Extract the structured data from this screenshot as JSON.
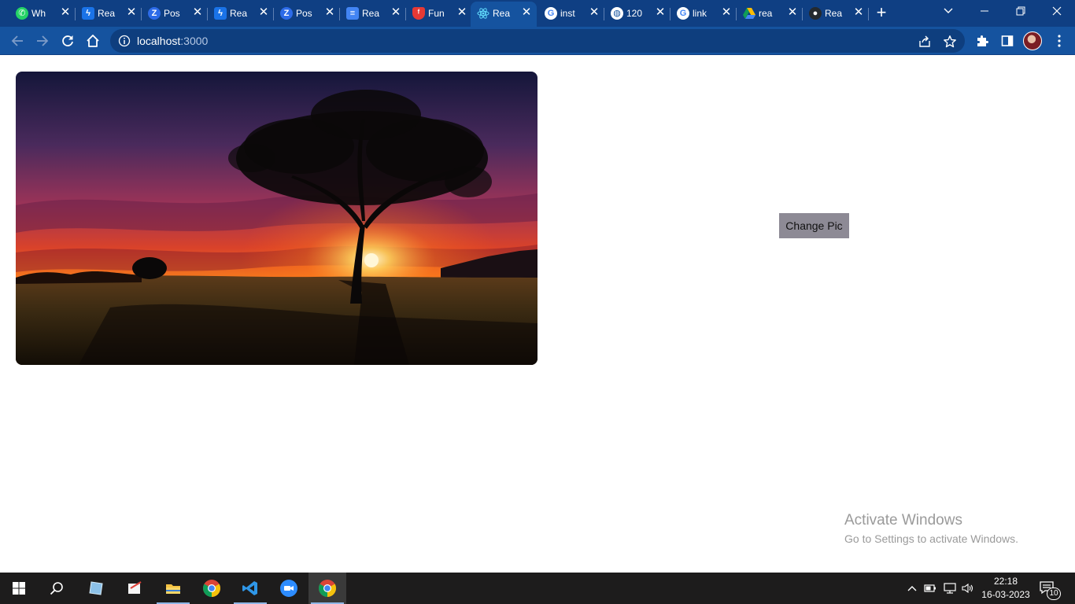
{
  "browser": {
    "tabs": [
      {
        "title": "Wh",
        "icon": "whatsapp-icon",
        "color": "#25d366"
      },
      {
        "title": "Rea",
        "icon": "bolt-icon",
        "color": "#1a73e8"
      },
      {
        "title": "Pos",
        "icon": "zoho-icon",
        "color": "#2d6be8"
      },
      {
        "title": "Rea",
        "icon": "bolt-icon",
        "color": "#1a73e8"
      },
      {
        "title": "Pos",
        "icon": "zoho-icon",
        "color": "#2d6be8"
      },
      {
        "title": "Rea",
        "icon": "docs-icon",
        "color": "#4285f4"
      },
      {
        "title": "Fun",
        "icon": "shield-icon",
        "color": "#e53935"
      },
      {
        "title": "Rea",
        "icon": "react-icon",
        "color": "#61dafb",
        "active": true
      },
      {
        "title": "inst",
        "icon": "google-icon",
        "color": "#ffffff"
      },
      {
        "title": "120",
        "icon": "globe-icon",
        "color": "#ffffff"
      },
      {
        "title": "link",
        "icon": "google-icon",
        "color": "#ffffff"
      },
      {
        "title": "rea",
        "icon": "drive-icon",
        "color": "#fbbc04"
      },
      {
        "title": "Rea",
        "icon": "github-icon",
        "color": "#24292e"
      }
    ],
    "close_glyph": "✕",
    "new_tab_glyph": "+",
    "address": {
      "host": "localhost",
      "port": ":3000"
    }
  },
  "page": {
    "button_label": "Change Pic"
  },
  "watermark": {
    "line1": "Activate Windows",
    "line2": "Go to Settings to activate Windows."
  },
  "taskbar": {
    "time": "22:18",
    "date": "16-03-2023",
    "notification_count": "10"
  },
  "colors": {
    "tabstrip": "#0f3f83",
    "toolbar": "#15539f",
    "button_bg": "#8d8a95",
    "taskbar": "#1d1c1c"
  }
}
